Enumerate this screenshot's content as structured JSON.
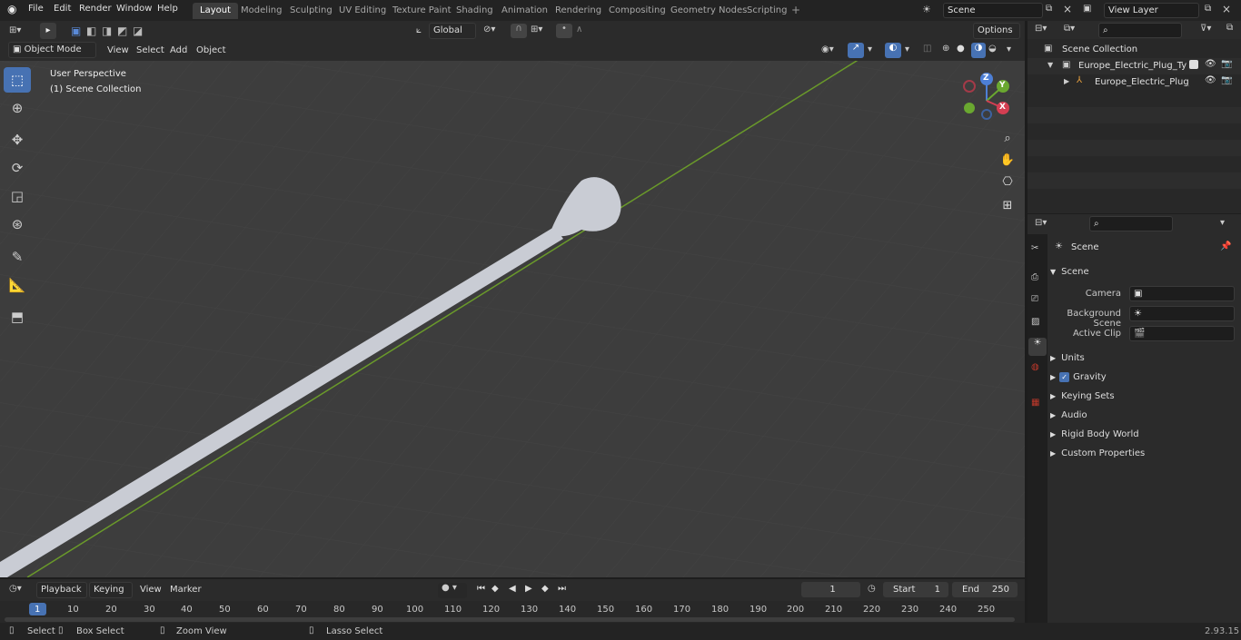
{
  "topbar": {
    "menus": [
      "File",
      "Edit",
      "Render",
      "Window",
      "Help"
    ],
    "tabs": [
      "Layout",
      "Modeling",
      "Sculpting",
      "UV Editing",
      "Texture Paint",
      "Shading",
      "Animation",
      "Rendering",
      "Compositing",
      "Geometry Nodes",
      "Scripting"
    ],
    "scene": "Scene",
    "view_layer": "View Layer"
  },
  "viewport": {
    "mode": "Object Mode",
    "menus": [
      "View",
      "Select",
      "Add",
      "Object"
    ],
    "orientation": "Global",
    "options": "Options",
    "perspective_label": "User Perspective",
    "collection_label": "(1) Scene Collection",
    "gizmo": {
      "z": "Z",
      "y": "Y",
      "x": "X"
    }
  },
  "outliner": {
    "root": "Scene Collection",
    "items": [
      "Europe_Electric_Plug_Type_E_",
      "Europe_Electric_Plug_Typ"
    ]
  },
  "properties": {
    "header": "Scene",
    "section": "Scene",
    "fields": [
      {
        "label": "Camera"
      },
      {
        "label": "Background Scene"
      },
      {
        "label": "Active Clip"
      }
    ],
    "panels": [
      "Units",
      "Gravity",
      "Keying Sets",
      "Audio",
      "Rigid Body World",
      "Custom Properties"
    ]
  },
  "timeline": {
    "menus": [
      "Playback",
      "Keying",
      "View",
      "Marker"
    ],
    "current_frame": "1",
    "start_label": "Start",
    "start": "1",
    "end_label": "End",
    "end": "250",
    "ruler": [
      "1",
      "10",
      "20",
      "30",
      "40",
      "50",
      "60",
      "70",
      "80",
      "90",
      "100",
      "110",
      "120",
      "130",
      "140",
      "150",
      "160",
      "170",
      "180",
      "190",
      "200",
      "210",
      "220",
      "230",
      "240",
      "250"
    ]
  },
  "status": {
    "select": "Select",
    "box_select": "Box Select",
    "zoom_view": "Zoom View",
    "lasso_select": "Lasso Select",
    "version": "2.93.15"
  }
}
